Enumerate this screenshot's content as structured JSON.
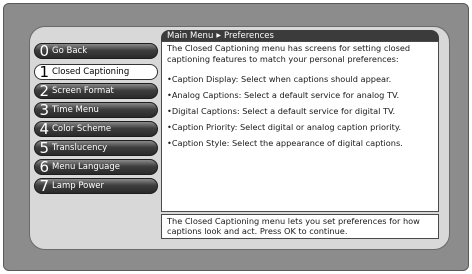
{
  "breadcrumb": {
    "root": "Main Menu",
    "current": "Preferences"
  },
  "menu": [
    {
      "number": "0",
      "label": "Go Back"
    },
    {
      "number": "1",
      "label": "Closed Captioning",
      "selected": true
    },
    {
      "number": "2",
      "label": "Screen Format"
    },
    {
      "number": "3",
      "label": "Time Menu"
    },
    {
      "number": "4",
      "label": "Color Scheme"
    },
    {
      "number": "5",
      "label": "Translucency"
    },
    {
      "number": "6",
      "label": "Menu Language"
    },
    {
      "number": "7",
      "label": "Lamp Power"
    }
  ],
  "content": {
    "intro": "The Closed Captioning menu has screens for setting closed captioning features to match your personal preferences:",
    "bullets": [
      "•Caption Display: Select when captions should appear.",
      "•Analog Captions: Select a default service for analog TV.",
      "•Digital Captions: Select a default service for digital TV.",
      "•Caption Priority: Select digital or analog caption priority.",
      "•Caption Style: Select the appearance of digital captions."
    ]
  },
  "footer": {
    "text": "The Closed Captioning menu lets you set preferences for how captions look and act. Press OK to continue."
  },
  "colors": {
    "screen_bg": "#8c8c8c",
    "panel_bg": "#d8d8d8",
    "button_dark": "#2a2a2a",
    "breadcrumb_bg": "#3b3b3b"
  },
  "icons": {
    "breadcrumb_separator": "triangle-right-icon"
  }
}
